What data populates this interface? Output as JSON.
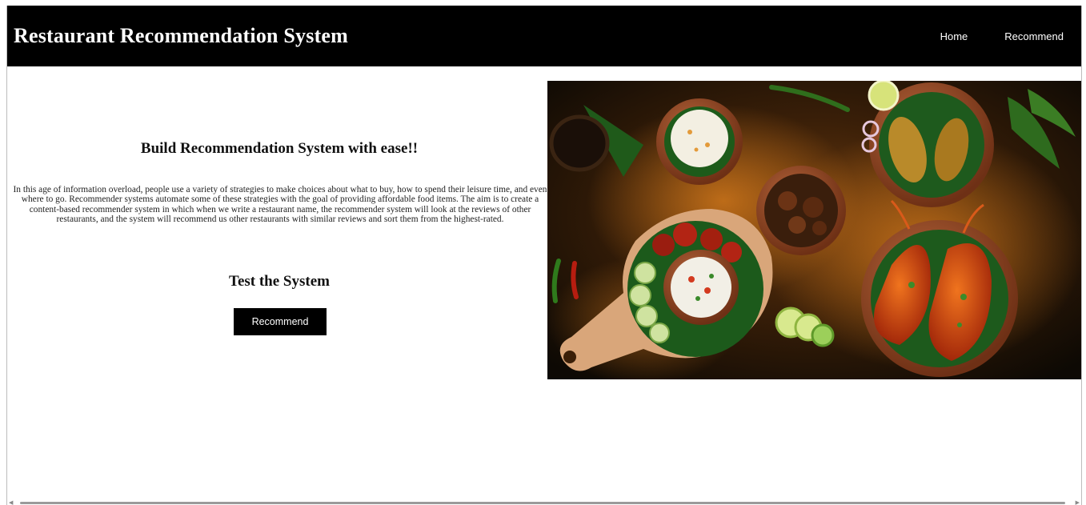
{
  "header": {
    "title": "Restaurant Recommendation System",
    "nav": [
      {
        "label": "Home"
      },
      {
        "label": "Recommend"
      }
    ]
  },
  "main": {
    "headline": "Build Recommendation System with ease!!",
    "description": "In this age of information overload, people use a variety of strategies to make choices about what to buy, how to spend their leisure time, and even where to go. Recommender systems automate some of these strategies with the goal of providing affordable food items. The aim is to create a content-based recommender system in which when we write a restaurant name, the recommender system will look at the reviews of other restaurants, and the system will recommend us other restaurants with similar reviews and sort them from the highest-rated.",
    "subheading": "Test the System",
    "cta_label": "Recommend"
  },
  "colors": {
    "navbar": "#000000",
    "button": "#000000",
    "page_background": "#ffffff"
  },
  "icons": {
    "scroll_left": "triangle-left",
    "scroll_right": "triangle-right"
  }
}
